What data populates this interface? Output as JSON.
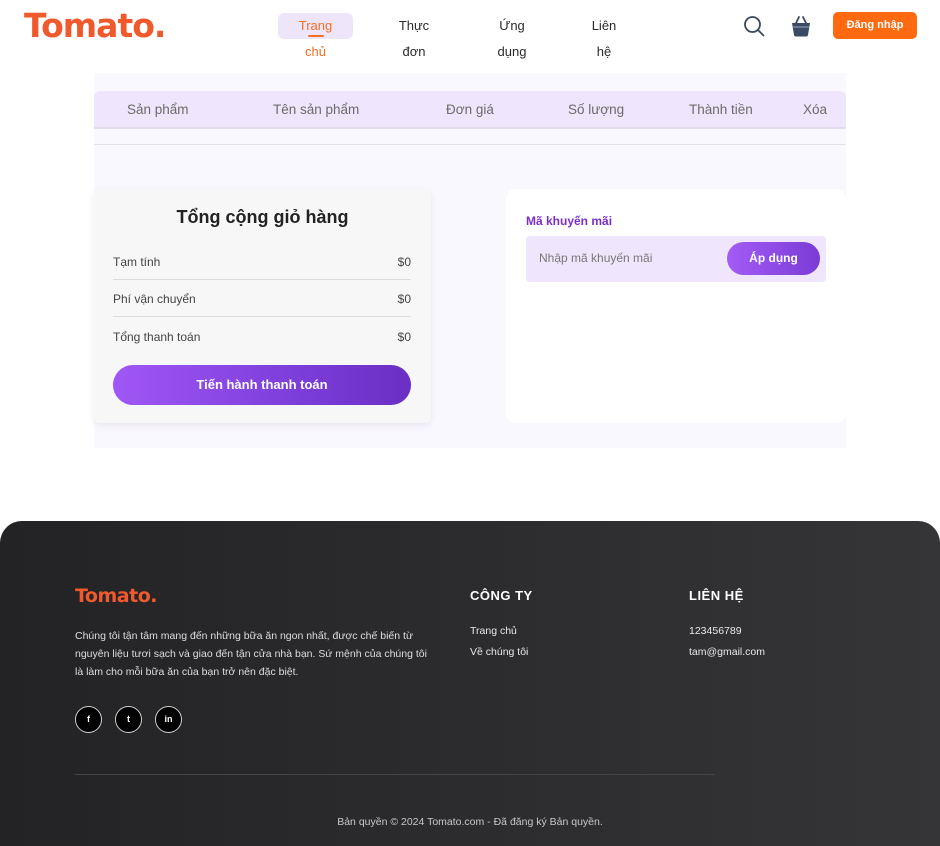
{
  "brand": {
    "logo": "Tomato.",
    "accent": "#f0592c",
    "purple": "#7b3bd6"
  },
  "nav": {
    "items": [
      {
        "label": "Trang chủ",
        "active": true
      },
      {
        "label": "Thực đơn",
        "active": false
      },
      {
        "label": "Ứng dụng",
        "active": false
      },
      {
        "label": "Liên hệ",
        "active": false
      }
    ],
    "login_label": "Đăng nhập"
  },
  "cart_table": {
    "headers": [
      "Sản phẩm",
      "Tên sản phẩm",
      "Đơn giá",
      "Số lượng",
      "Thành tiền",
      "Xóa"
    ],
    "rows": []
  },
  "totals": {
    "title": "Tổng cộng giỏ hàng",
    "subtotal_label": "Tạm tính",
    "subtotal_value": "$0",
    "shipping_label": "Phí vận chuyển",
    "shipping_value": "$0",
    "total_label": "Tổng thanh toán",
    "total_value": "$0",
    "checkout_label": "Tiến hành thanh toán"
  },
  "promo": {
    "label": "Mã khuyến mãi",
    "placeholder": "Nhập mã khuyến mãi",
    "apply_label": "Áp dụng"
  },
  "footer": {
    "logo": "Tomato.",
    "description": "Chúng tôi tận tâm mang đến những bữa ăn ngon nhất, được chế biến từ nguyên liệu tươi sạch và giao đến tận cửa nhà bạn. Sứ mệnh của chúng tôi là làm cho mỗi bữa ăn của bạn trở nên đặc biệt.",
    "social": [
      "f",
      "t",
      "in"
    ],
    "company": {
      "heading": "CÔNG TY",
      "links": [
        "Trang chủ",
        "Về chúng tôi"
      ]
    },
    "contact": {
      "heading": "LIÊN HỆ",
      "phone": "123456789",
      "email": "tam@gmail.com"
    },
    "copyright": "Bản quyền © 2024 Tomato.com - Đã đăng ký Bản quyền."
  }
}
